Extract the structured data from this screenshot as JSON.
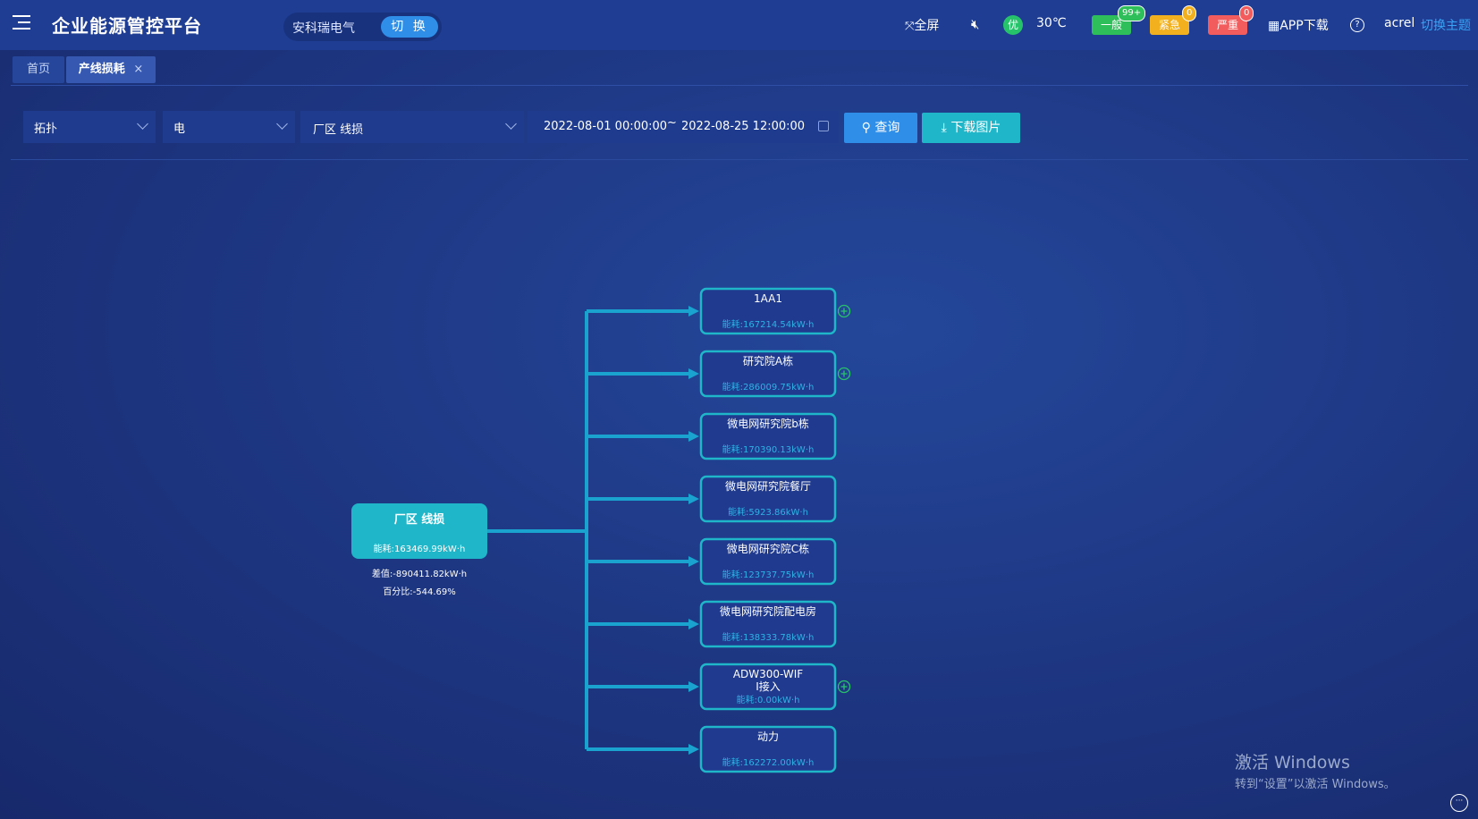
{
  "header": {
    "app_title": "企业能源管控平台",
    "company": "安科瑞电气",
    "switch_label": "切 换",
    "fullscreen_label": "全屏",
    "quality": "优",
    "temperature": "30℃",
    "alarms": [
      {
        "label": "一般",
        "count": "99+",
        "color": "#2fbf5a",
        "badge_color": "#2fbf5a"
      },
      {
        "label": "紧急",
        "count": "0",
        "color": "#f2b01e",
        "badge_color": "#f2b01e"
      },
      {
        "label": "严重",
        "count": "0",
        "color": "#f25c5c",
        "badge_color": "#f25c5c"
      }
    ],
    "app_download": "APP下载",
    "user": "acrel",
    "theme_switch": "切换主题"
  },
  "tabs": [
    {
      "label": "首页",
      "active": false
    },
    {
      "label": "产线损耗",
      "active": true
    }
  ],
  "filters": {
    "view": "拓扑",
    "energy": "电",
    "node": "厂区 线损",
    "start": "2022-08-01 00:00:00",
    "sep": "~",
    "end": "2022-08-25 12:00:00",
    "query_label": "查询",
    "download_label": "下载图片"
  },
  "topology": {
    "root": {
      "name": "厂区 线损",
      "energy": "能耗:163469.99kW·h",
      "diff": "差值:-890411.82kW·h",
      "percent": "百分比:-544.69%"
    },
    "children": [
      {
        "name": "1AA1",
        "energy": "能耗:167214.54kW·h",
        "expandable": true
      },
      {
        "name": "研究院A栋",
        "energy": "能耗:286009.75kW·h",
        "expandable": true
      },
      {
        "name": "微电网研究院b栋",
        "energy": "能耗:170390.13kW·h",
        "expandable": false
      },
      {
        "name": "微电网研究院餐厅",
        "energy": "能耗:5923.86kW·h",
        "expandable": false
      },
      {
        "name": "微电网研究院C栋",
        "energy": "能耗:123737.75kW·h",
        "expandable": false
      },
      {
        "name": "微电网研究院配电房",
        "energy": "能耗:138333.78kW·h",
        "expandable": false
      },
      {
        "name": "ADW300-WIF\nI接入",
        "energy": "能耗:0.00kW·h",
        "expandable": true
      },
      {
        "name": "动力",
        "energy": "能耗:162272.00kW·h",
        "expandable": false
      }
    ]
  },
  "watermark": {
    "line1": "激活 Windows",
    "line2": "转到“设置”以激活 Windows。"
  },
  "colors": {
    "accent": "#2f8ee8",
    "teal": "#1fb6c9",
    "line": "#1aa3cf"
  }
}
